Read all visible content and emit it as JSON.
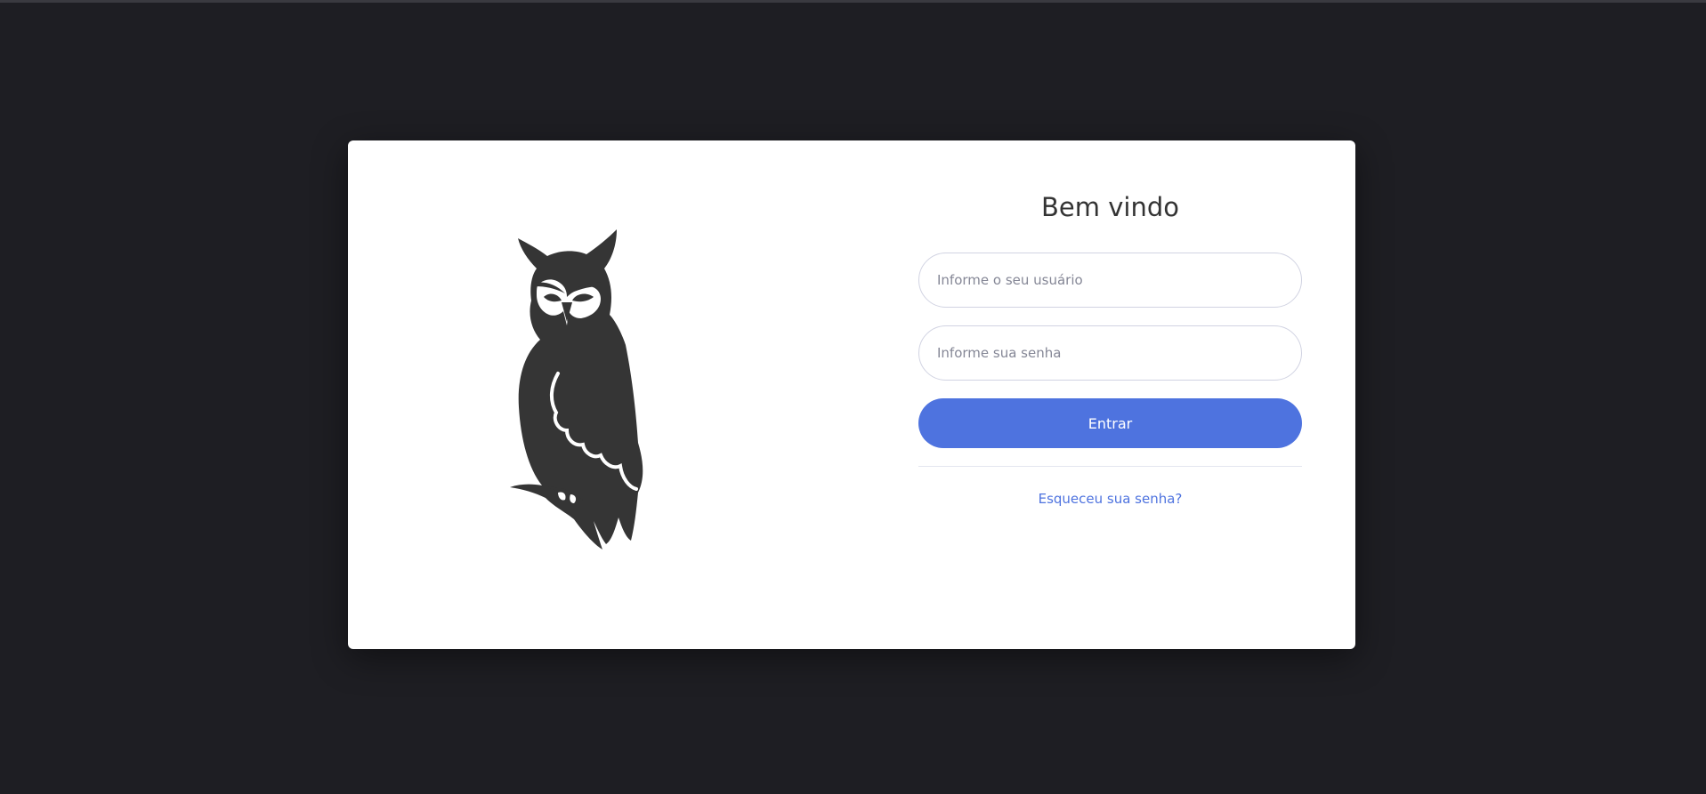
{
  "login": {
    "title": "Bem vindo",
    "username_placeholder": "Informe o seu usuário",
    "password_placeholder": "Informe sua senha",
    "submit_label": "Entrar",
    "forgot_password_label": "Esqueceu sua senha?"
  },
  "logo": {
    "icon": "owl-icon",
    "color": "#353535"
  },
  "theme": {
    "background": "#1e1e23",
    "card": "#ffffff",
    "accent": "#4e73df"
  }
}
